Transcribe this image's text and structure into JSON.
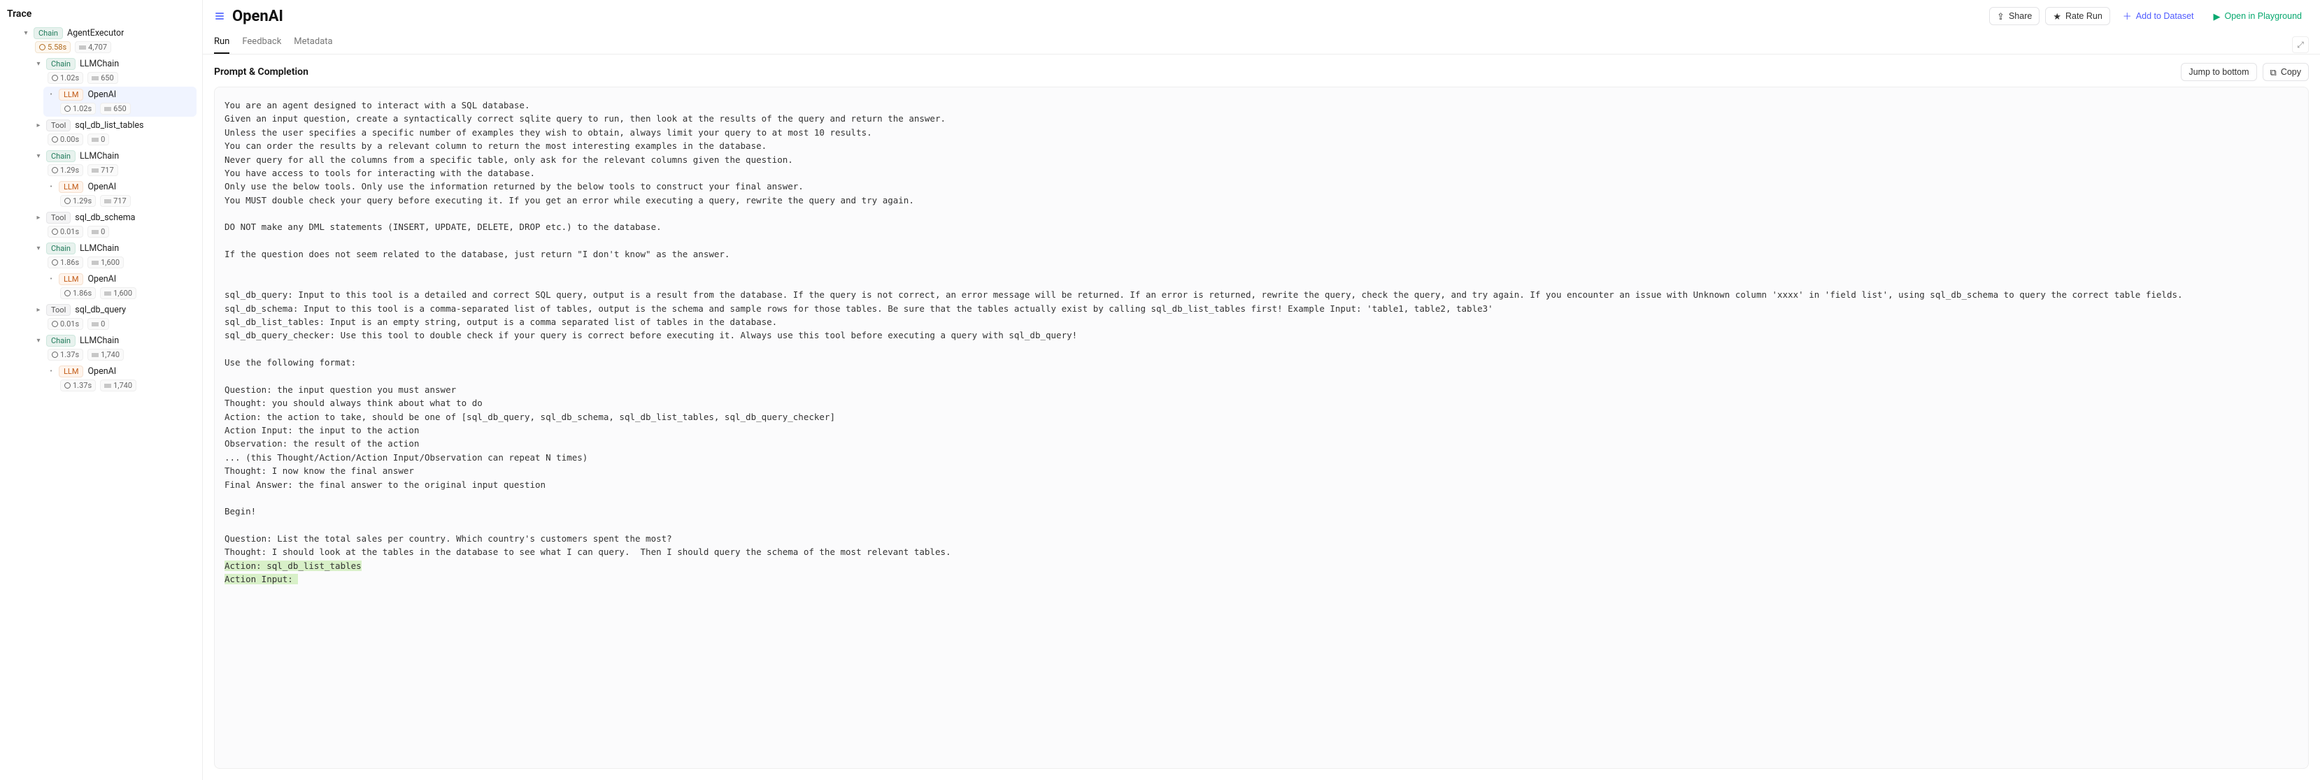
{
  "sidebar": {
    "title": "Trace",
    "nodes": [
      {
        "id": 0,
        "indent": 1,
        "toggle": "down",
        "kind": "Chain",
        "kindClass": "kind-chain",
        "name": "AgentExecutor",
        "time": "5.58s",
        "timeWarn": true,
        "tokens": "4,707",
        "selected": false
      },
      {
        "id": 1,
        "indent": 2,
        "toggle": "down",
        "kind": "Chain",
        "kindClass": "kind-chain",
        "name": "LLMChain",
        "time": "1.02s",
        "tokens": "650"
      },
      {
        "id": 2,
        "indent": 3,
        "toggle": "dot",
        "kind": "LLM",
        "kindClass": "kind-llm",
        "name": "OpenAI",
        "time": "1.02s",
        "tokens": "650",
        "selected": true
      },
      {
        "id": 3,
        "indent": 2,
        "toggle": "right",
        "kind": "Tool",
        "kindClass": "kind-tool",
        "name": "sql_db_list_tables",
        "time": "0.00s",
        "tokens": "0"
      },
      {
        "id": 4,
        "indent": 2,
        "toggle": "down",
        "kind": "Chain",
        "kindClass": "kind-chain",
        "name": "LLMChain",
        "time": "1.29s",
        "tokens": "717"
      },
      {
        "id": 5,
        "indent": 3,
        "toggle": "dot",
        "kind": "LLM",
        "kindClass": "kind-llm",
        "name": "OpenAI",
        "time": "1.29s",
        "tokens": "717"
      },
      {
        "id": 6,
        "indent": 2,
        "toggle": "right",
        "kind": "Tool",
        "kindClass": "kind-tool",
        "name": "sql_db_schema",
        "time": "0.01s",
        "tokens": "0"
      },
      {
        "id": 7,
        "indent": 2,
        "toggle": "down",
        "kind": "Chain",
        "kindClass": "kind-chain",
        "name": "LLMChain",
        "time": "1.86s",
        "tokens": "1,600"
      },
      {
        "id": 8,
        "indent": 3,
        "toggle": "dot",
        "kind": "LLM",
        "kindClass": "kind-llm",
        "name": "OpenAI",
        "time": "1.86s",
        "tokens": "1,600"
      },
      {
        "id": 9,
        "indent": 2,
        "toggle": "right",
        "kind": "Tool",
        "kindClass": "kind-tool",
        "name": "sql_db_query",
        "time": "0.01s",
        "tokens": "0"
      },
      {
        "id": 10,
        "indent": 2,
        "toggle": "down",
        "kind": "Chain",
        "kindClass": "kind-chain",
        "name": "LLMChain",
        "time": "1.37s",
        "tokens": "1,740"
      },
      {
        "id": 11,
        "indent": 3,
        "toggle": "dot",
        "kind": "LLM",
        "kindClass": "kind-llm",
        "name": "OpenAI",
        "time": "1.37s",
        "tokens": "1,740"
      }
    ]
  },
  "header": {
    "title": "OpenAI",
    "actions": {
      "share": "Share",
      "rate": "Rate Run",
      "add": "Add to Dataset",
      "playground": "Open in Playground"
    }
  },
  "tabs": [
    {
      "label": "Run",
      "active": true
    },
    {
      "label": "Feedback",
      "active": false
    },
    {
      "label": "Metadata",
      "active": false
    }
  ],
  "section": {
    "title": "Prompt & Completion",
    "jump": "Jump to bottom",
    "copy": "Copy"
  },
  "prompt": {
    "body": "You are an agent designed to interact with a SQL database.\nGiven an input question, create a syntactically correct sqlite query to run, then look at the results of the query and return the answer.\nUnless the user specifies a specific number of examples they wish to obtain, always limit your query to at most 10 results.\nYou can order the results by a relevant column to return the most interesting examples in the database.\nNever query for all the columns from a specific table, only ask for the relevant columns given the question.\nYou have access to tools for interacting with the database.\nOnly use the below tools. Only use the information returned by the below tools to construct your final answer.\nYou MUST double check your query before executing it. If you get an error while executing a query, rewrite the query and try again.\n\nDO NOT make any DML statements (INSERT, UPDATE, DELETE, DROP etc.) to the database.\n\nIf the question does not seem related to the database, just return \"I don't know\" as the answer.\n\n\nsql_db_query: Input to this tool is a detailed and correct SQL query, output is a result from the database. If the query is not correct, an error message will be returned. If an error is returned, rewrite the query, check the query, and try again. If you encounter an issue with Unknown column 'xxxx' in 'field list', using sql_db_schema to query the correct table fields.\nsql_db_schema: Input to this tool is a comma-separated list of tables, output is the schema and sample rows for those tables. Be sure that the tables actually exist by calling sql_db_list_tables first! Example Input: 'table1, table2, table3'\nsql_db_list_tables: Input is an empty string, output is a comma separated list of tables in the database.\nsql_db_query_checker: Use this tool to double check if your query is correct before executing it. Always use this tool before executing a query with sql_db_query!\n\nUse the following format:\n\nQuestion: the input question you must answer\nThought: you should always think about what to do\nAction: the action to take, should be one of [sql_db_query, sql_db_schema, sql_db_list_tables, sql_db_query_checker]\nAction Input: the input to the action\nObservation: the result of the action\n... (this Thought/Action/Action Input/Observation can repeat N times)\nThought: I now know the final answer\nFinal Answer: the final answer to the original input question\n\nBegin!\n\nQuestion: List the total sales per country. Which country's customers spent the most?\nThought: I should look at the tables in the database to see what I can query.  Then I should query the schema of the most relevant tables.\n",
    "hl1": "Action: sql_db_list_tables",
    "hl2": "Action Input: "
  }
}
